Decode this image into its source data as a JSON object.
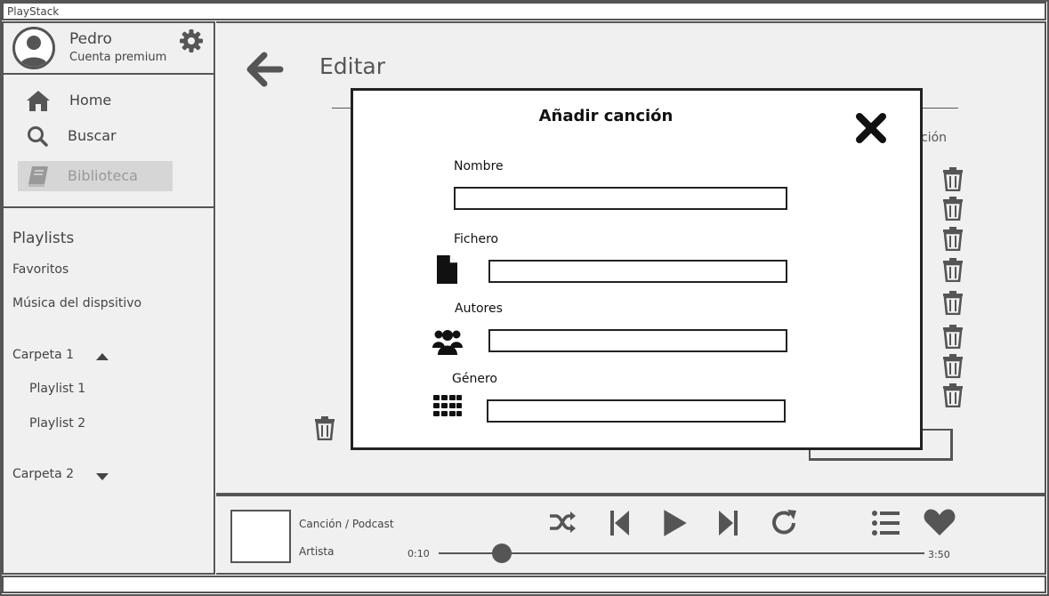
{
  "app": {
    "title": "PlayStack"
  },
  "user": {
    "name": "Pedro",
    "plan": "Cuenta premium"
  },
  "nav": {
    "items": [
      {
        "label": "Home"
      },
      {
        "label": "Buscar"
      },
      {
        "label": "Biblioteca"
      }
    ]
  },
  "playlists": {
    "title": "Playlists",
    "items": [
      "Favoritos",
      "Música del dispsitivo"
    ],
    "folders": [
      {
        "label": "Carpeta 1",
        "expanded": true,
        "playlists": [
          "Playlist 1",
          "Playlist 2"
        ]
      },
      {
        "label": "Carpeta 2",
        "expanded": false
      }
    ]
  },
  "editor": {
    "title": "Editar",
    "column_fragment": "ción",
    "row_count": 8
  },
  "player": {
    "song": "Canción / Podcast",
    "artist": "Artista",
    "elapsed": "0:10",
    "duration": "3:50",
    "progress_fraction": 0.13
  },
  "modal": {
    "title": "Añadir canción",
    "fields": [
      {
        "label": "Nombre",
        "value": "",
        "icon": null
      },
      {
        "label": "Fichero",
        "value": "",
        "icon": "file-icon"
      },
      {
        "label": "Autores",
        "value": "",
        "icon": "users-icon"
      },
      {
        "label": "Género",
        "value": "",
        "icon": "grid-icon"
      }
    ]
  },
  "colors": {
    "ink": "#222222",
    "panel": "#f0f0f0",
    "muted": "#999999"
  }
}
